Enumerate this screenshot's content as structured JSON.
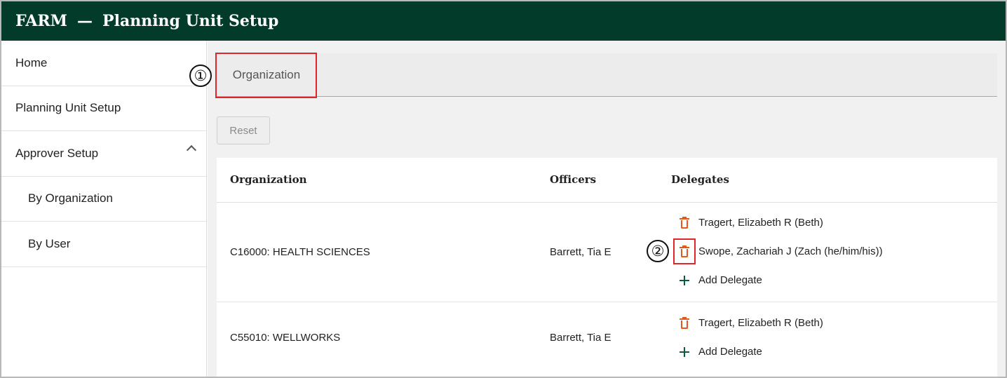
{
  "header": {
    "app_name": "FARM",
    "separator": "—",
    "page_title": "Planning Unit Setup"
  },
  "sidebar": {
    "items": [
      {
        "label": "Home"
      },
      {
        "label": "Planning Unit Setup"
      },
      {
        "label": "Approver Setup",
        "expanded": true
      },
      {
        "label": "By Organization"
      },
      {
        "label": "By User"
      }
    ]
  },
  "tabs": [
    {
      "label": "Organization",
      "active": true
    }
  ],
  "callouts": {
    "one": "①",
    "two": "②"
  },
  "toolbar": {
    "reset_label": "Reset"
  },
  "table": {
    "columns": [
      "Organization",
      "Officers",
      "Delegates"
    ],
    "rows": [
      {
        "organization": "C16000: HEALTH SCIENCES",
        "officers": "Barrett, Tia E",
        "delegates": [
          "Tragert, Elizabeth R (Beth)",
          "Swope, Zachariah J (Zach (he/him/his))"
        ],
        "add_label": "Add Delegate"
      },
      {
        "organization": "C55010: WELLWORKS",
        "officers": "Barrett, Tia E",
        "delegates": [
          "Tragert, Elizabeth R (Beth)"
        ],
        "add_label": "Add Delegate"
      }
    ]
  },
  "colors": {
    "brand_green": "#023b2a",
    "delete_orange": "#e45a1b",
    "highlight_red": "#e0262b",
    "add_green": "#0a5a3c"
  }
}
